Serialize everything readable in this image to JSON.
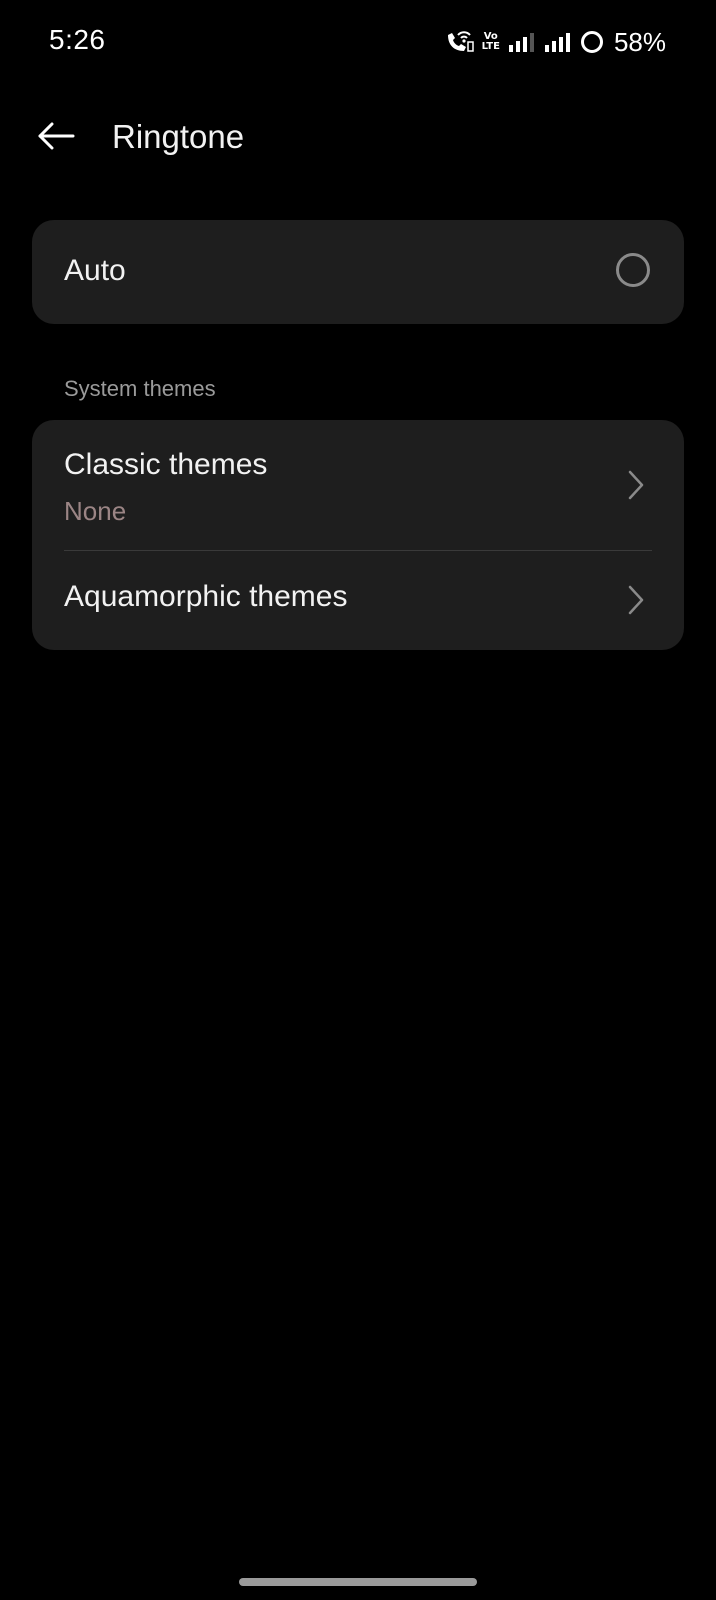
{
  "status_bar": {
    "time": "5:26",
    "volte_top": "Vo",
    "volte_bottom": "LTE",
    "battery_percent": "58%",
    "icons": [
      "wifi-calling-icon",
      "volte-icon",
      "signal-sim1-icon",
      "signal-sim2-icon",
      "battery-ring-icon"
    ]
  },
  "app_bar": {
    "back_icon": "arrow-left-icon",
    "title": "Ringtone"
  },
  "auto_option": {
    "label": "Auto",
    "selected": false
  },
  "system_themes": {
    "header": "System themes",
    "items": [
      {
        "label": "Classic themes",
        "value": "None",
        "icon": "chevron-right-icon"
      },
      {
        "label": "Aquamorphic themes",
        "icon": "chevron-right-icon"
      }
    ]
  },
  "colors": {
    "background": "#000000",
    "card": "#1e1e1e",
    "primary_text": "#f2f2f2",
    "secondary_text": "#9a9a9a",
    "value_text": "#9b8585"
  }
}
